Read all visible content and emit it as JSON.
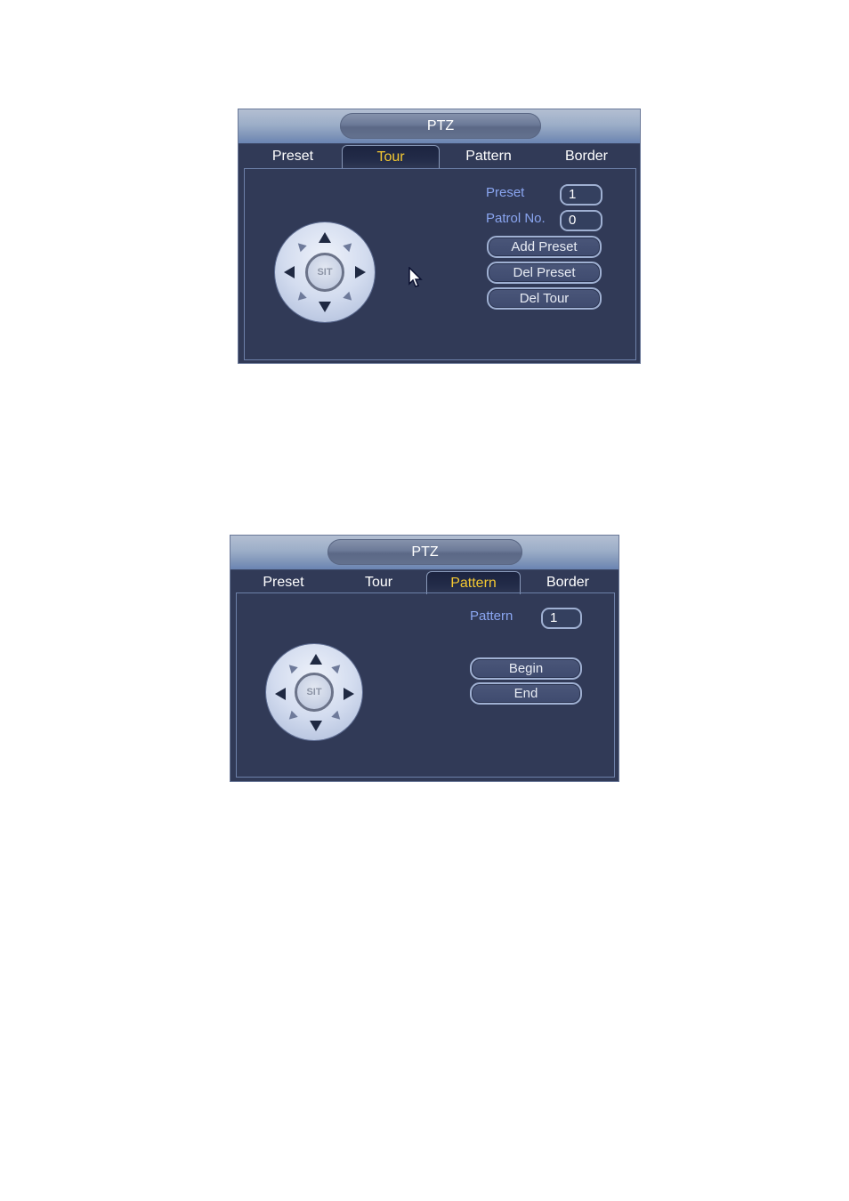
{
  "dialogs": [
    {
      "title": "PTZ",
      "tabs": [
        {
          "label": "Preset",
          "active": false
        },
        {
          "label": "Tour",
          "active": true
        },
        {
          "label": "Pattern",
          "active": false
        },
        {
          "label": "Border",
          "active": false
        }
      ],
      "joystick": {
        "center_label": "SIT"
      },
      "fields": [
        {
          "label": "Preset",
          "value": "1"
        },
        {
          "label": "Patrol No.",
          "value": "0"
        }
      ],
      "buttons": [
        "Add Preset",
        "Del Preset",
        "Del Tour"
      ]
    },
    {
      "title": "PTZ",
      "tabs": [
        {
          "label": "Preset",
          "active": false
        },
        {
          "label": "Tour",
          "active": false
        },
        {
          "label": "Pattern",
          "active": true
        },
        {
          "label": "Border",
          "active": false
        }
      ],
      "joystick": {
        "center_label": "SIT"
      },
      "fields": [
        {
          "label": "Pattern",
          "value": "1"
        }
      ],
      "buttons": [
        "Begin",
        "End"
      ]
    }
  ],
  "colors": {
    "background": "#313a57",
    "active_tab_text": "#f4c832",
    "label_text": "#8aa5f0"
  }
}
